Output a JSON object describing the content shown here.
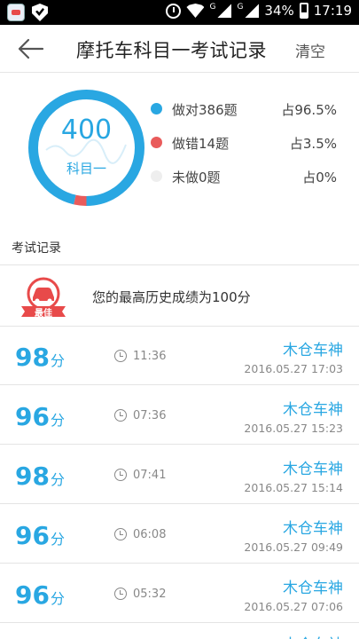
{
  "status_bar": {
    "battery": "34%",
    "time": "17:19",
    "network_labels": [
      "G",
      "G"
    ],
    "icons": [
      "app-icon",
      "shield-check-icon",
      "alarm-icon",
      "wifi-icon",
      "signal-icon",
      "signal-icon",
      "battery-icon"
    ]
  },
  "header": {
    "title": "摩托车科目一考试记录",
    "clear_label": "清空",
    "back_icon": "arrow-left-icon"
  },
  "summary": {
    "total": "400",
    "subject": "科目一",
    "correct_fraction": 0.965,
    "wrong_fraction": 0.035,
    "legend": [
      {
        "label": "做对386题",
        "pct": "占96.5%",
        "color": "#29a7e2"
      },
      {
        "label": "做错14题",
        "pct": "占3.5%",
        "color": "#e95b5b"
      },
      {
        "label": "未做0题",
        "pct": "占0%",
        "color": "#eeeeee"
      }
    ]
  },
  "records": {
    "section_title": "考试记录",
    "best": {
      "badge_label": "最佳",
      "text": "您的最高历史成绩为100分"
    },
    "items": [
      {
        "score": "98",
        "unit": "分",
        "duration": "11:36",
        "user": "木仓车神",
        "date": "2016.05.27  17:03"
      },
      {
        "score": "96",
        "unit": "分",
        "duration": "07:36",
        "user": "木仓车神",
        "date": "2016.05.27  15:23"
      },
      {
        "score": "98",
        "unit": "分",
        "duration": "07:41",
        "user": "木仓车神",
        "date": "2016.05.27  15:14"
      },
      {
        "score": "96",
        "unit": "分",
        "duration": "06:08",
        "user": "木仓车神",
        "date": "2016.05.27  09:49"
      },
      {
        "score": "96",
        "unit": "分",
        "duration": "05:32",
        "user": "木仓车神",
        "date": "2016.05.27  07:06"
      }
    ],
    "peek_user": "木仓车神"
  },
  "colors": {
    "accent": "#29a7e2",
    "wrong": "#e95b5b",
    "badge": "#e84a4a"
  }
}
